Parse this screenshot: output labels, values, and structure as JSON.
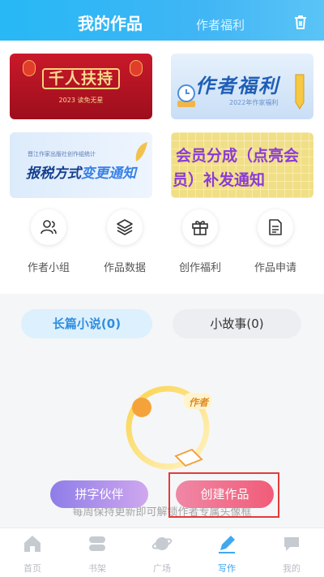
{
  "header": {
    "tab_main": "我的作品",
    "tab_sub": "作者福利",
    "trash_icon": "trash-icon"
  },
  "banners": [
    {
      "title": "千人扶持",
      "subtitle": "2023 读免无星"
    },
    {
      "title": "作者福利",
      "subtitle": "2022年作家福利"
    },
    {
      "subtitle": "晋江作家出版社创作组统计",
      "title_a": "报税方式",
      "title_b": "变更通知"
    },
    {
      "line1": "会员分成（点亮会",
      "line2": "员）补发通知"
    }
  ],
  "functions": [
    {
      "label": "作者小组",
      "icon": "group-icon"
    },
    {
      "label": "作品数据",
      "icon": "layers-icon"
    },
    {
      "label": "创作福利",
      "icon": "gift-icon"
    },
    {
      "label": "作品申请",
      "icon": "document-icon"
    }
  ],
  "categories": {
    "long": "长篇小说(0)",
    "short": "小故事(0)"
  },
  "ring": {
    "badge": "作者"
  },
  "hint": "每周保持更新即可解锁作者专属头像框",
  "buttons": {
    "partner": "拼字伙伴",
    "create": "创建作品"
  },
  "tabbar": [
    {
      "label": "首页",
      "icon": "home-icon",
      "active": false
    },
    {
      "label": "书架",
      "icon": "bookshelf-icon",
      "active": false
    },
    {
      "label": "广场",
      "icon": "planet-icon",
      "active": false
    },
    {
      "label": "写作",
      "icon": "pen-icon",
      "active": true
    },
    {
      "label": "我的",
      "icon": "chat-icon",
      "active": false
    }
  ]
}
